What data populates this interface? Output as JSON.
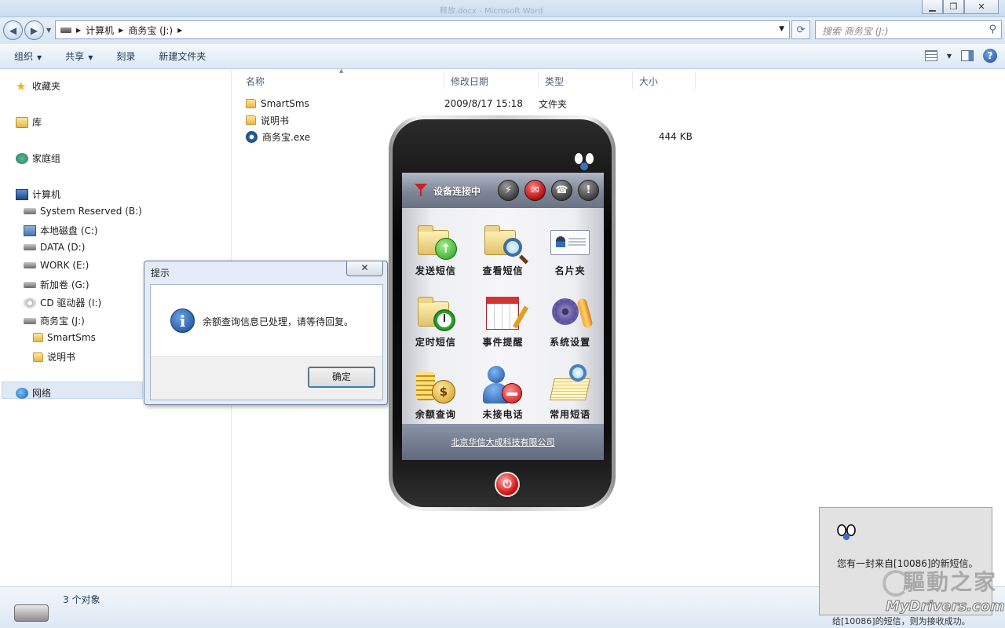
{
  "explorer": {
    "ghost_title": "释放.docx - Microsoft Word",
    "breadcrumb": [
      "计算机",
      "商务宝 (J:)"
    ],
    "search_placeholder": "搜索 商务宝 (J:)",
    "toolbar": {
      "organize": "组织",
      "share": "共享",
      "burn": "刻录",
      "new_folder": "新建文件夹"
    },
    "nav": {
      "favorites": "收藏夹",
      "libraries": "库",
      "homegroup": "家庭组",
      "computer": "计算机",
      "drives": [
        "System Reserved (B:)",
        "本地磁盘 (C:)",
        "DATA (D:)",
        "WORK (E:)",
        "新加卷 (G:)",
        "CD 驱动器 (I:)",
        "商务宝 (J:)"
      ],
      "subfolders": [
        "SmartSms",
        "说明书"
      ],
      "network": "网络"
    },
    "columns": {
      "name": "名称",
      "modified": "修改日期",
      "type": "类型",
      "size": "大小"
    },
    "files": [
      {
        "name": "SmartSms",
        "modified": "2009/8/17 15:18",
        "type": "文件夹",
        "size": ""
      },
      {
        "name": "说明书",
        "modified": "",
        "type": "",
        "size": ""
      },
      {
        "name": "商务宝.exe",
        "modified": "",
        "type": "",
        "size": "444 KB"
      }
    ],
    "status": "3 个对象"
  },
  "dialog": {
    "title": "提示",
    "close": "✕",
    "message": "余额查询信息已处理，请等待回复。",
    "ok": "确定"
  },
  "phone": {
    "status": "设备连接中",
    "header_icons": [
      "signal-icon",
      "mail-icon",
      "phone-icon",
      "alert-icon"
    ],
    "tiles": [
      "发送短信",
      "查看短信",
      "名片夹",
      "定时短信",
      "事件提醒",
      "系统设置",
      "余额查询",
      "未接电话",
      "常用短语"
    ],
    "company": "北京华信大成科技有限公司"
  },
  "notification": {
    "message": "您有一封来自[10086]的新短信。",
    "partial_text": "给[10086]的短信，则为接收成功。"
  },
  "watermark": {
    "cn": "驅動之家",
    "en": "MyDrivers.com"
  }
}
